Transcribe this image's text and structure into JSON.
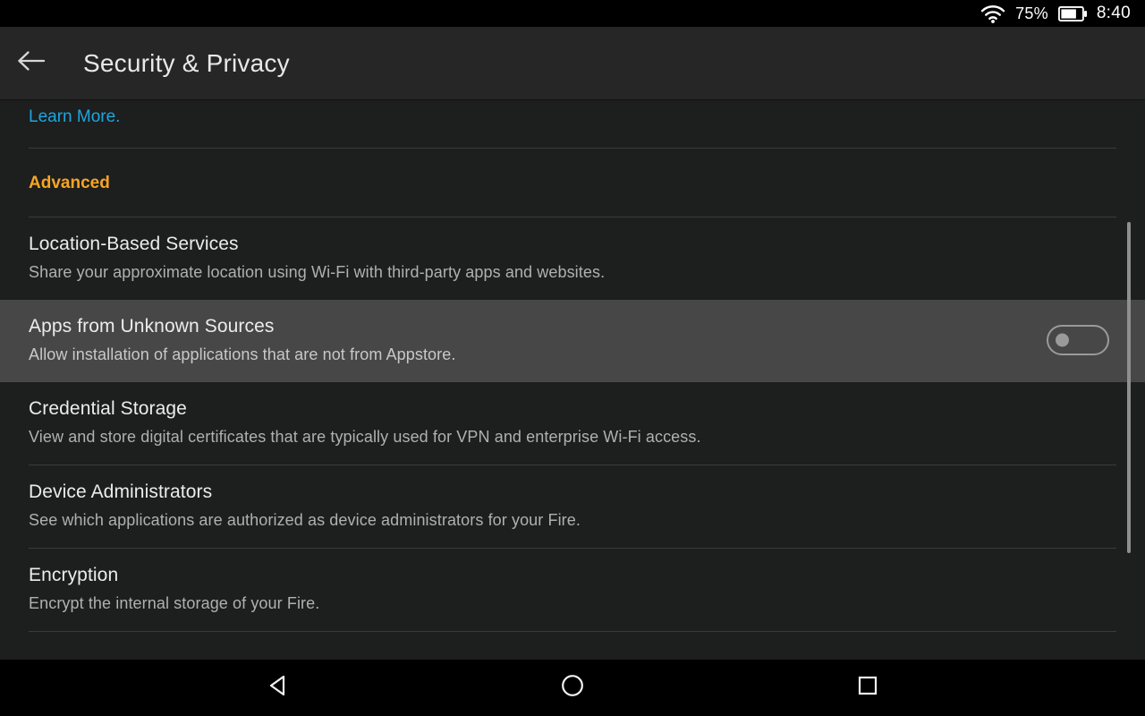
{
  "status_bar": {
    "wifi_icon": "wifi-icon",
    "battery_percent": "75%",
    "battery_icon": "battery-icon",
    "battery_level": 75,
    "clock": "8:40"
  },
  "header": {
    "back_icon": "back-arrow-icon",
    "title": "Security & Privacy"
  },
  "content": {
    "learn_more_label": "Learn More.",
    "section_header": "Advanced",
    "items": [
      {
        "title": "Location-Based Services",
        "subtitle": "Share your approximate location using Wi-Fi with third-party apps and websites.",
        "has_toggle": false,
        "highlighted": false
      },
      {
        "title": "Apps from Unknown Sources",
        "subtitle": "Allow installation of applications that are not from Appstore.",
        "has_toggle": true,
        "toggle_state": "off",
        "highlighted": true
      },
      {
        "title": "Credential Storage",
        "subtitle": "View and store digital certificates that are typically used for VPN and enterprise Wi-Fi access.",
        "has_toggle": false,
        "highlighted": false
      },
      {
        "title": "Device Administrators",
        "subtitle": "See which applications are authorized as device administrators for your Fire.",
        "has_toggle": false,
        "highlighted": false
      },
      {
        "title": "Encryption",
        "subtitle": "Encrypt the internal storage of your Fire.",
        "has_toggle": false,
        "highlighted": false
      }
    ]
  },
  "nav_bar": {
    "back_icon": "nav-back-triangle-icon",
    "home_icon": "nav-home-circle-icon",
    "recents_icon": "nav-recents-square-icon"
  },
  "colors": {
    "background": "#1d1e1e",
    "header_background": "#262626",
    "highlight_row": "#474747",
    "accent_orange": "#f5a623",
    "link_blue": "#1ba7e0",
    "divider": "#3a3a3a",
    "nav_background": "#000000"
  }
}
